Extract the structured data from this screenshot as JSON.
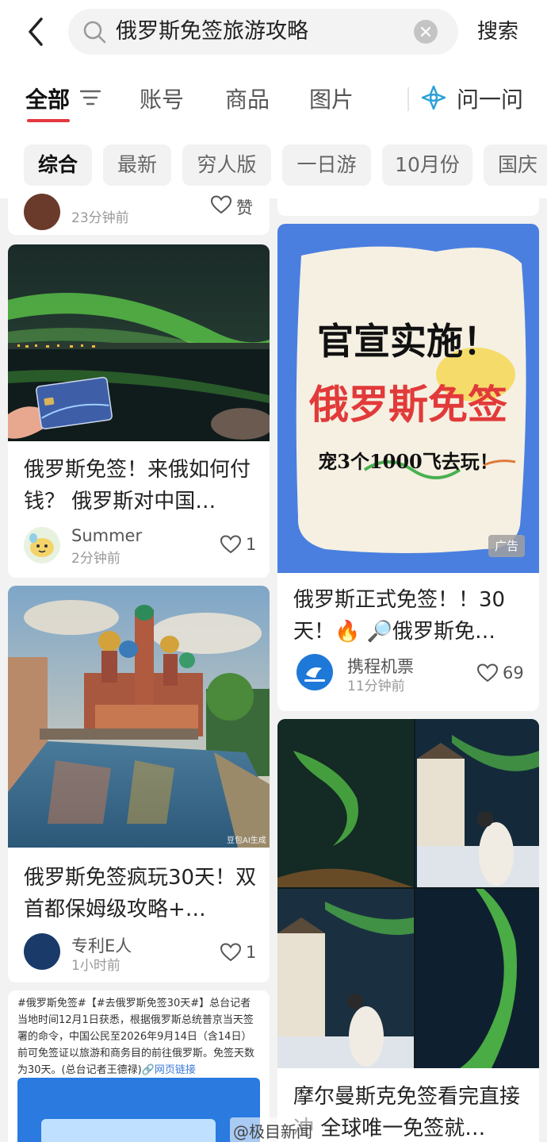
{
  "search_bar": {
    "query": "俄罗斯免签旅游攻略",
    "submit_label": "搜索"
  },
  "tabs": {
    "items": [
      "全部",
      "账号",
      "商品",
      "图片"
    ],
    "ask_label": "问一问"
  },
  "chips": [
    "综合",
    "最新",
    "穷人版",
    "一日游",
    "10月份",
    "国庆"
  ],
  "cards": {
    "top_left_partial": {
      "time": "23分钟前",
      "like_label": "赞"
    },
    "payment": {
      "title": "俄罗斯免签！来俄如何付钱？ 俄罗斯对中国…",
      "author": "Summer",
      "time": "2分钟前",
      "likes": "1"
    },
    "ad": {
      "headline": "官宣实施！",
      "main": "俄罗斯免签",
      "sub": "宠3个1000飞去玩！",
      "ad_label": "广告",
      "title": "俄罗斯正式免签！！30天！🔥 🔎俄罗斯免…",
      "author": "携程机票",
      "time": "11分钟前",
      "likes": "69"
    },
    "painting": {
      "watermark": "豆包AI生成",
      "title": "俄罗斯免签疯玩30天！双首都保姆级攻略+…",
      "author": "专利E人",
      "time": "1小时前",
      "likes": "1"
    },
    "aurora": {
      "title": "摩尔曼斯克免签看完直接冲 全球唯一免签就…"
    },
    "news": {
      "text": "#俄罗斯免签#【#去俄罗斯免签30天#】总台记者当地时间12月1日获悉，根据俄罗斯总统普京当天签署的命令，中国公民至2026年9月14日（含14日）前可免签证以旅游和商务目的前往俄罗斯。免签天数为30天。(总台记者王德禄)",
      "link": "网页链接"
    }
  },
  "watermark": "@极目新闻"
}
